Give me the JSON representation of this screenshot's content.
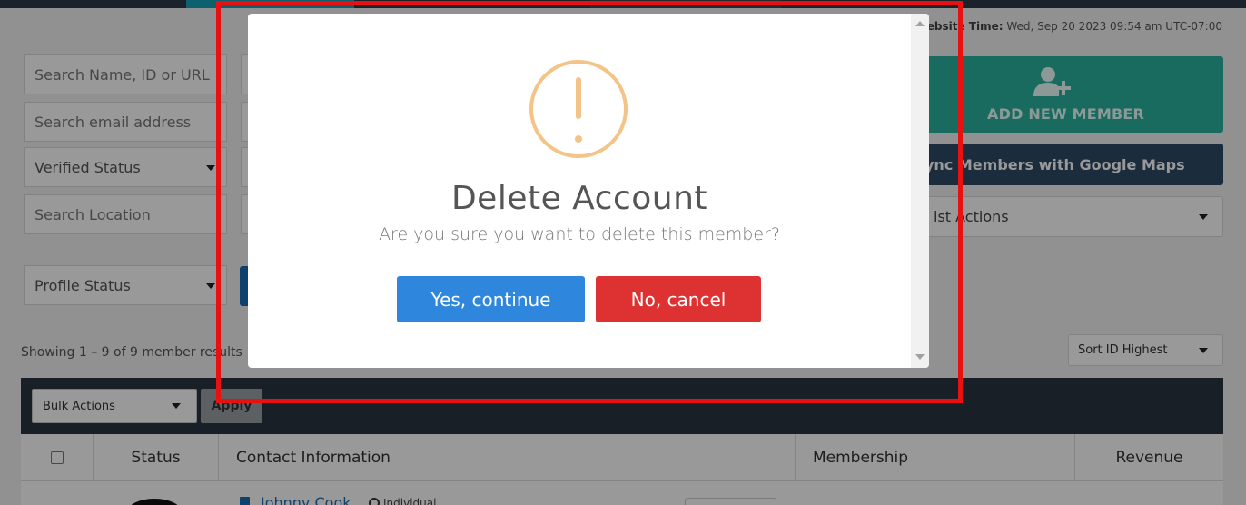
{
  "header": {
    "website_time_label": "Website Time:",
    "website_time_value": "Wed, Sep 20 2023 09:54 am UTC-07:00"
  },
  "filters": {
    "search_name_placeholder": "Search Name, ID or URL",
    "search_email_placeholder": "Search email address",
    "verified_status": "Verified Status",
    "search_location_placeholder": "Search Location",
    "profile_status": "Profile Status"
  },
  "actions": {
    "add_member": "ADD NEW MEMBER",
    "sync_maps": "ync Members with Google Maps",
    "list_actions": "ist Actions"
  },
  "results": {
    "count_text": "Showing 1 – 9 of 9 member results",
    "sort_selected": "Sort ID Highest"
  },
  "table": {
    "bulk_actions": "Bulk Actions",
    "apply": "Apply",
    "columns": [
      "Status",
      "Contact Information",
      "Membership",
      "Revenue"
    ],
    "first_row": {
      "name": "Johnny Cook",
      "type": "Individual"
    }
  },
  "modal": {
    "icon": "warning-circle-icon",
    "title": "Delete Account",
    "message": "Are you sure you want to delete this member?",
    "confirm_label": "Yes, continue",
    "cancel_label": "No, cancel"
  },
  "colors": {
    "confirm": "#2f86dd",
    "cancel": "#de3232",
    "warning": "#f4c387",
    "highlight": "#e81010",
    "add_member": "#2bb3a0"
  }
}
